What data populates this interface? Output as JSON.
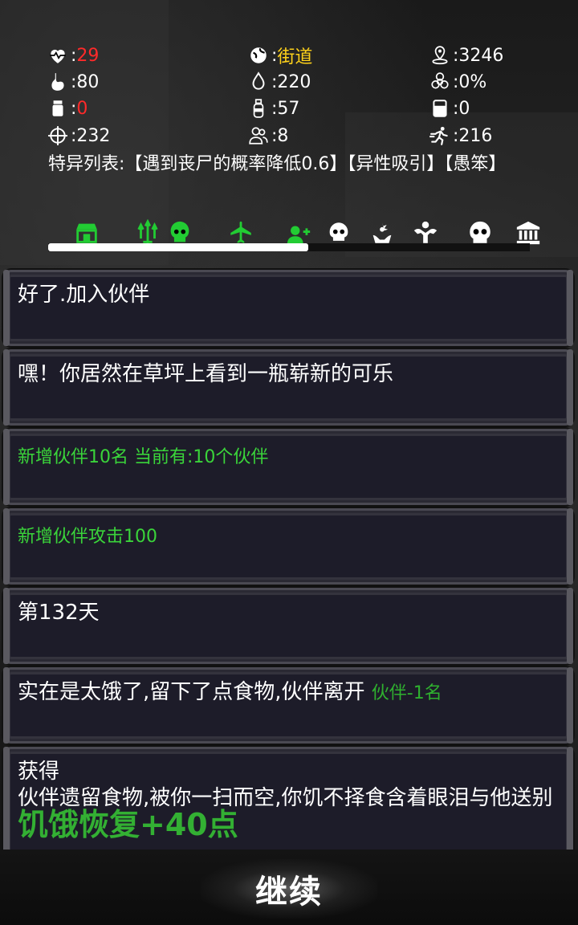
{
  "stats": {
    "health": "29",
    "location": "街道",
    "distance": "3246",
    "hunger": "80",
    "water": "220",
    "infection": "0%",
    "ammo": "0",
    "supplies": "57",
    "container": "0",
    "attack": "232",
    "companions": "8",
    "speed": "216"
  },
  "traits": "特异列表:【遇到丧尸的概率降低0.6】【异性吸引】【愚笨】",
  "tabs": [
    {
      "icon": "shop-icon"
    },
    {
      "icon": "weapons-icon"
    },
    {
      "icon": "skull-icon"
    },
    {
      "icon": "airplane-icon"
    },
    {
      "icon": "add-companion-icon"
    },
    {
      "icon": "skull-icon"
    },
    {
      "icon": "trade-icon"
    },
    {
      "icon": "strength-icon"
    },
    {
      "icon": "skull-icon"
    },
    {
      "icon": "bank-icon"
    }
  ],
  "progress": 0.54,
  "log": {
    "p1": "好了.加入伙伴",
    "p2": "嘿！你居然在草坪上看到一瓶崭新的可乐",
    "p3": "新增伙伴10名  当前有:10个伙伴",
    "p4": "新增伙伴攻击100",
    "p5": "第132天",
    "p6_text": "实在是太饿了,留下了点食物,伙伴离开 ",
    "p6_green": "伙伴-1名",
    "p7_line1": "获得",
    "p7_line2": "伙伴遗留食物,被你一扫而空,你饥不择食含着眼泪与他送别 ",
    "p7_green": "饥饿恢复+40点"
  },
  "continue_label": "继续",
  "colors": {
    "danger": "#ff2a2a",
    "location": "#ffd21a",
    "good": "#3ad43a",
    "tab_active": "#22cc33"
  }
}
